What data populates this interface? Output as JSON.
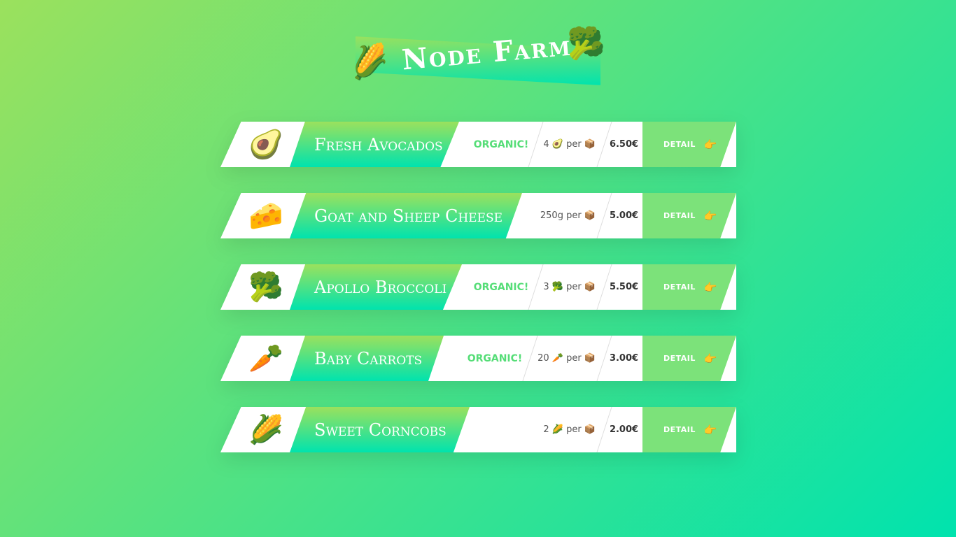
{
  "header": {
    "title": "Node Farm",
    "emoji_left": "🌽",
    "emoji_right": "🥦"
  },
  "products": [
    {
      "emoji": "🥑",
      "name": "Fresh Avocados",
      "organic": true,
      "organic_label": "ORGANIC!",
      "quantity": "4 🥑 per 📦",
      "price": "6.50€",
      "detail_label": "DETAIL",
      "detail_icon": "👉"
    },
    {
      "emoji": "🧀",
      "name": "Goat and Sheep Cheese",
      "organic": false,
      "organic_label": "",
      "quantity": "250g per 📦",
      "price": "5.00€",
      "detail_label": "DETAIL",
      "detail_icon": "👉"
    },
    {
      "emoji": "🥦",
      "name": "Apollo Broccoli",
      "organic": true,
      "organic_label": "ORGANIC!",
      "quantity": "3 🥦 per 📦",
      "price": "5.50€",
      "detail_label": "DETAIL",
      "detail_icon": "👉"
    },
    {
      "emoji": "🥕",
      "name": "Baby Carrots",
      "organic": true,
      "organic_label": "ORGANIC!",
      "quantity": "20 🥕 per 📦",
      "price": "3.00€",
      "detail_label": "DETAIL",
      "detail_icon": "👉"
    },
    {
      "emoji": "🌽",
      "name": "Sweet Corncobs",
      "organic": false,
      "organic_label": "",
      "quantity": "2 🌽 per 📦",
      "price": "2.00€",
      "detail_label": "DETAIL",
      "detail_icon": "👉"
    }
  ],
  "colors": {
    "gradient_start": "#9be15d",
    "gradient_end": "#00e3ae",
    "organic_text": "#55dd77",
    "detail_bg": "#7ce27a"
  }
}
